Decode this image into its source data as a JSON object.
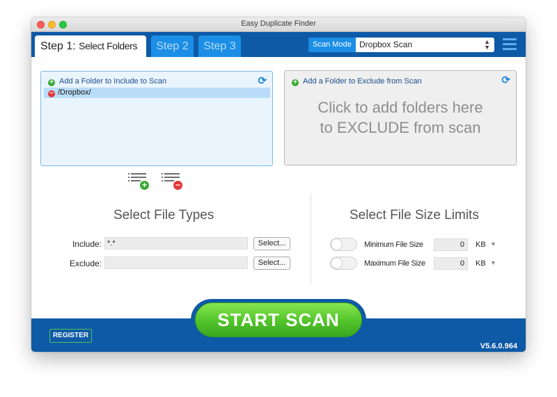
{
  "window": {
    "title": "Easy Duplicate Finder"
  },
  "tabs": {
    "step1_prefix": "Step 1:",
    "step1_label": "Select Folders",
    "step2": "Step 2",
    "step3": "Step 3"
  },
  "scan_mode": {
    "label": "Scan Mode",
    "value": "Dropbox Scan"
  },
  "include_panel": {
    "header": "Add a Folder to Include to Scan",
    "folders": [
      "/Dropbox/"
    ]
  },
  "exclude_panel": {
    "header": "Add a Folder to Exclude from Scan",
    "placeholder_line1": "Click to add folders here",
    "placeholder_line2": "to EXCLUDE from scan"
  },
  "file_types": {
    "title": "Select File Types",
    "include_label": "Include:",
    "include_value": "*.*",
    "exclude_label": "Exclude:",
    "exclude_value": "",
    "select_button": "Select..."
  },
  "file_size": {
    "title": "Select File Size Limits",
    "min_label": "Minimum File Size",
    "min_value": "0",
    "max_label": "Maximum File Size",
    "max_value": "0",
    "unit": "KB"
  },
  "footer": {
    "register": "REGISTER",
    "start_scan": "START  SCAN",
    "version": "V5.6.0.964"
  }
}
